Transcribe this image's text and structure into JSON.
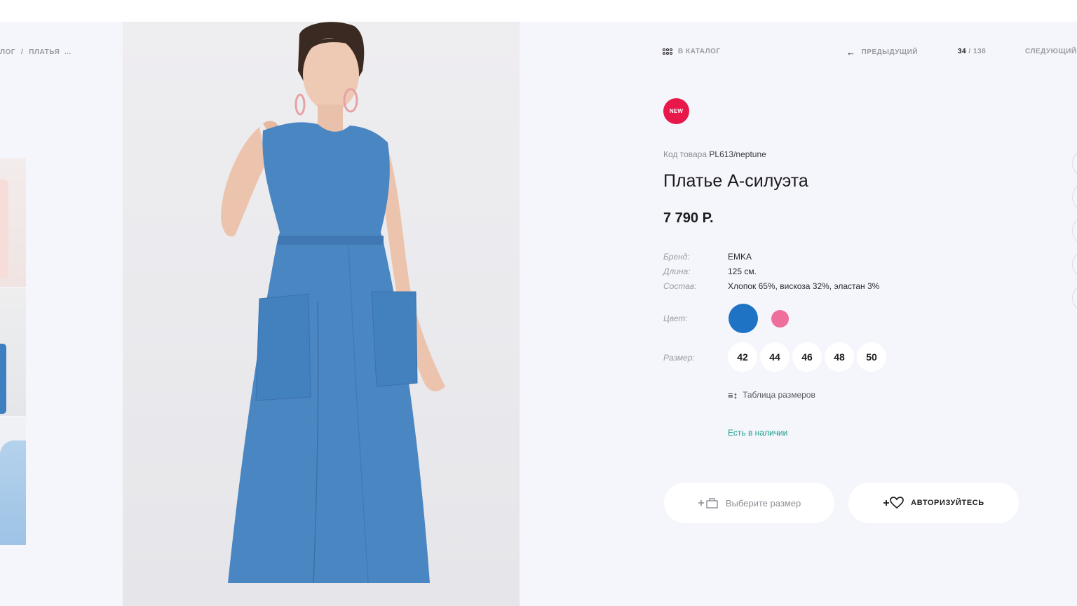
{
  "breadcrumb": {
    "items": [
      "ЛОГ",
      "/",
      "ПЛАТЬЯ",
      "..."
    ]
  },
  "nav": {
    "catalog_label": "В КАТАЛОГ",
    "prev_label": "ПРЕДЫДУЩИЙ",
    "current": "34",
    "separator": "/",
    "total": "138",
    "next_label": "СЛЕДУЮЩИЙ"
  },
  "product": {
    "badge": "NEW",
    "sku_label": "Код товара",
    "sku": "PL613/neptune",
    "title": "Платье А-силуэта",
    "price": "7 790 Р.",
    "props": [
      {
        "key": "Бренд:",
        "value": "EMKA"
      },
      {
        "key": "Длина:",
        "value": "125 см."
      },
      {
        "key": "Состав:",
        "value": "Хлопок 65%, вискоза 32%, эластан 3%"
      }
    ],
    "color_label": "Цвет:",
    "colors": [
      "#1e73c5",
      "#ee6f9c"
    ],
    "size_label": "Размер:",
    "sizes": [
      "42",
      "44",
      "46",
      "48",
      "50"
    ],
    "size_table_label": "Таблица размеров",
    "stock_label": "Есть в наличии"
  },
  "actions": {
    "cart_label": "Выберите размер",
    "auth_label": "АВТОРИЗУЙТЕСЬ"
  },
  "icons": {
    "catalog": "catalog-grid-icon",
    "prev": "arrow-left-icon",
    "cart": "cart-plus-icon",
    "wishlist": "heart-plus-icon",
    "size_table": "ruler-icon"
  }
}
